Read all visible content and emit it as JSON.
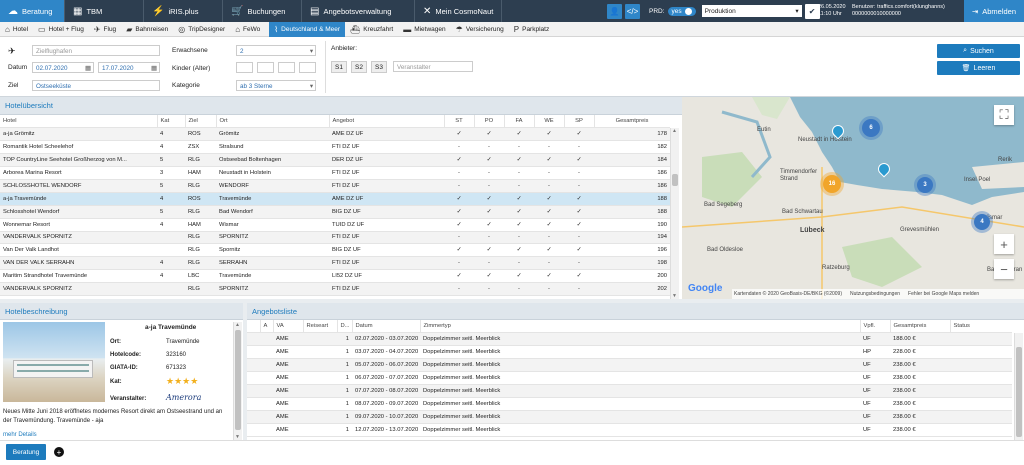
{
  "topnav": [
    {
      "label": "Beratung",
      "icon": "☁",
      "active": true
    },
    {
      "label": "TBM",
      "icon": "▦"
    },
    {
      "label": "iRIS.plus",
      "icon": "⚡"
    },
    {
      "label": "Buchungen",
      "icon": "🛒"
    },
    {
      "label": "Angebotsverwaltung",
      "icon": "▤"
    },
    {
      "label": "Mein CosmoNaut",
      "icon": "✕"
    }
  ],
  "header": {
    "prd_label": "PRD:",
    "prd_toggle": "yes",
    "environment": "Produktion",
    "date": "26.05.2020",
    "time": "11:10 Uhr",
    "user_line": "Benutzer: traffics.comfort(klunghanns)",
    "user_id": "0000000010000000",
    "logout": "Abmelden"
  },
  "subnav": [
    {
      "label": "Hotel",
      "icon": "⌂"
    },
    {
      "label": "Hotel + Flug",
      "icon": "▭"
    },
    {
      "label": "Flug",
      "icon": "✈"
    },
    {
      "label": "Bahnreisen",
      "icon": "▰"
    },
    {
      "label": "TripDesigner",
      "icon": "◎"
    },
    {
      "label": "FeWo",
      "icon": "⌂"
    },
    {
      "label": "Deutschland & Meer",
      "icon": "⌇",
      "active": true
    },
    {
      "label": "Kreuzfahrt",
      "icon": "⛴"
    },
    {
      "label": "Mietwagen",
      "icon": "▬"
    },
    {
      "label": "Versicherung",
      "icon": "☂"
    },
    {
      "label": "Parkplatz",
      "icon": "P"
    }
  ],
  "search": {
    "flight_placeholder": "Zielflughafen",
    "date_label": "Datum",
    "date_from": "02.07.2020",
    "date_to": "17.07.2020",
    "ziel_label": "Ziel",
    "ziel": "Ostseeküste",
    "adults_label": "Erwachsene",
    "adults": "2",
    "children_label": "Kinder (Alter)",
    "category_label": "Kategorie",
    "category": "ab 3 Sterne",
    "anbieter_label": "Anbieter",
    "s_buttons": [
      "S1",
      "S2",
      "S3"
    ],
    "veranstalter_placeholder": "Veranstalter",
    "search_btn": "Suchen",
    "clear_btn": "Leeren"
  },
  "hotels": {
    "title": "Hotelübersicht",
    "headers": [
      "Hotel",
      "Kat",
      "Ziel",
      "Ort",
      "Angebot",
      "ST",
      "PO",
      "FA",
      "WE",
      "SP",
      "Gesamtpreis"
    ],
    "rows": [
      [
        "a-ja Grömitz",
        "4",
        "ROS",
        "Grömitz",
        "AME DZ UF",
        "✓",
        "✓",
        "✓",
        "✓",
        "✓",
        "178"
      ],
      [
        "Romantik Hotel Scheelehof",
        "4",
        "ZSX",
        "Stralsund",
        "FTI DZ UF",
        "-",
        "-",
        "-",
        "-",
        "-",
        "182"
      ],
      [
        "TOP CountryLine Seehotel Großherzog von M...",
        "5",
        "RLG",
        "Ostseebad Boltenhagen",
        "DER DZ UF",
        "✓",
        "✓",
        "✓",
        "✓",
        "✓",
        "184"
      ],
      [
        "Arborea Marina Resort",
        "3",
        "HAM",
        "Neustadt in Holstein",
        "FTI DZ UF",
        "-",
        "-",
        "-",
        "-",
        "-",
        "186"
      ],
      [
        "SCHLOSSHOTEL WENDORF",
        "5",
        "RLG",
        "WENDORF",
        "FTI DZ UF",
        "-",
        "-",
        "-",
        "-",
        "-",
        "186"
      ],
      [
        "a-ja Travemünde",
        "4",
        "ROS",
        "Travemünde",
        "AME DZ UF",
        "✓",
        "✓",
        "✓",
        "✓",
        "✓",
        "188"
      ],
      [
        "Schlosshotel Wendorf",
        "5",
        "RLG",
        "Bad Wendorf",
        "BIG DZ UF",
        "✓",
        "✓",
        "✓",
        "✓",
        "✓",
        "188"
      ],
      [
        "Wonnemar Resort",
        "4",
        "HAM",
        "Wismar",
        "TUID DZ UF",
        "✓",
        "✓",
        "✓",
        "✓",
        "✓",
        "190"
      ],
      [
        "VANDERVALK SPORNITZ",
        "",
        "RLG",
        "SPORNITZ",
        "FTI DZ UF",
        "-",
        "-",
        "-",
        "-",
        "-",
        "194"
      ],
      [
        "Van Der Valk Landhot",
        "",
        "RLG",
        "Spornitz",
        "BIG DZ UF",
        "✓",
        "✓",
        "✓",
        "✓",
        "✓",
        "196"
      ],
      [
        "VAN DER VALK SERRAHN",
        "4",
        "RLG",
        "SERRAHN",
        "FTI DZ UF",
        "-",
        "-",
        "-",
        "-",
        "-",
        "198"
      ],
      [
        "Maritim Strandhotel Travemünde",
        "4",
        "LBC",
        "Travemünde",
        "LI52 DZ UF",
        "✓",
        "✓",
        "✓",
        "✓",
        "✓",
        "200"
      ],
      [
        "VANDERVALK SPORNITZ",
        "",
        "RLG",
        "SPORNITZ",
        "FTI DZ UF",
        "-",
        "-",
        "-",
        "-",
        "-",
        "202"
      ]
    ],
    "selected_index": 5
  },
  "map": {
    "clusters": [
      "6",
      "16",
      "3",
      "4"
    ],
    "pin_count": 2,
    "places": [
      "Eutin",
      "Neustadt in Holstein",
      "Timmendorfer Strand",
      "Bad Segeberg",
      "Bad Schwartau",
      "Lübeck",
      "Bad Oldesloe",
      "Ratzeburg",
      "Grevesmühlen",
      "Wismar",
      "Insel Poel",
      "Rerik",
      "Bad Doberan"
    ],
    "google": "Google",
    "attribution": "Kartendaten © 2020 GeoBasis-DE/BKG (©2009)",
    "terms": "Nutzungsbedingungen",
    "report": "Fehler bei Google Maps melden"
  },
  "detail": {
    "title": "Hotelbeschreibung",
    "hotel_name": "a-ja Travemünde",
    "ort_label": "Ort:",
    "ort": "Travemünde",
    "code_label": "Hotelcode:",
    "code": "323160",
    "giata_label": "GIATA-ID:",
    "giata": "671323",
    "kat_label": "Kat:",
    "stars": "★★★★",
    "va_label": "Veranstalter:",
    "va_logo": "Amerora",
    "description": "Neues Mitte Juni 2018 eröffnetes modernes Resort direkt am Ostseestrand und an der Travemündung. Travemünde - aja",
    "more": "mehr Details",
    "beratung_btn": "Beratung"
  },
  "offers": {
    "title": "Angebotsliste",
    "headers": [
      "",
      "A",
      "VA",
      "Reiseart",
      "D...",
      "Datum",
      "Zimmertyp",
      "Vpfl.",
      "Gesamtpreis",
      "Status"
    ],
    "rows": [
      [
        "AME",
        "1",
        "02.07.2020 - 03.07.2020",
        "Doppelzimmer seitl. Meerblick",
        "UF",
        "188.00 €"
      ],
      [
        "AME",
        "1",
        "03.07.2020 - 04.07.2020",
        "Doppelzimmer seitl. Meerblick",
        "HP",
        "228.00 €"
      ],
      [
        "AME",
        "1",
        "05.07.2020 - 06.07.2020",
        "Doppelzimmer seitl. Meerblick",
        "UF",
        "238.00 €"
      ],
      [
        "AME",
        "1",
        "06.07.2020 - 07.07.2020",
        "Doppelzimmer seitl. Meerblick",
        "UF",
        "238.00 €"
      ],
      [
        "AME",
        "1",
        "07.07.2020 - 08.07.2020",
        "Doppelzimmer seitl. Meerblick",
        "UF",
        "238.00 €"
      ],
      [
        "AME",
        "1",
        "08.07.2020 - 09.07.2020",
        "Doppelzimmer seitl. Meerblick",
        "UF",
        "238.00 €"
      ],
      [
        "AME",
        "1",
        "09.07.2020 - 10.07.2020",
        "Doppelzimmer seitl. Meerblick",
        "UF",
        "238.00 €"
      ],
      [
        "AME",
        "1",
        "12.07.2020 - 13.07.2020",
        "Doppelzimmer seitl. Meerblick",
        "UF",
        "238.00 €"
      ]
    ]
  }
}
